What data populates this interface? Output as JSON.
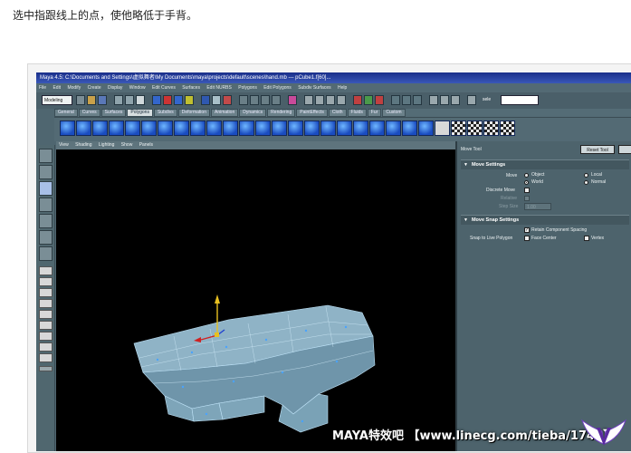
{
  "caption": "选中指跟线上的点，使他略低于手背。",
  "maya": {
    "title": "Maya 4.5: C:\\Documents and Settings\\虚拟舞者\\My Documents\\maya\\projects\\default\\scenes\\hand.mb  ---  pCube1.f[60]...",
    "menus": [
      "File",
      "Edit",
      "Modify",
      "Create",
      "Display",
      "Window",
      "Edit Curves",
      "Surfaces",
      "Edit NURBS",
      "Polygons",
      "Edit Polygons",
      "Subdiv Surfaces",
      "Help"
    ],
    "mode": "Modeling",
    "select_label": "sele",
    "shelf_tabs": [
      "General",
      "Curves",
      "Surfaces",
      "Polygons",
      "Subdivs",
      "Deformation",
      "Animation",
      "Dynamics",
      "Rendering",
      "PaintEffects",
      "Cloth",
      "Fluids",
      "Fur",
      "Custom"
    ],
    "active_shelf_tab": "Polygons",
    "panel_menus": [
      "View",
      "Shading",
      "Lighting",
      "Show",
      "Panels"
    ],
    "tool_settings": {
      "title": "Move Tool",
      "reset_label": "Reset Tool",
      "section1": "Move Settings",
      "move_label": "Move",
      "opt_object": "Object",
      "opt_local": "Local",
      "opt_world": "World",
      "opt_normal": "Normal",
      "discrete_label": "Discrete Move",
      "relative_label": "Relative",
      "stepsize_label": "Step Size",
      "stepsize_value": "1.00",
      "section2": "Move Snap Settings",
      "retain_label": "Retain Component Spacing",
      "snap_label": "Snap to Live Polygon",
      "face_center": "Face Center",
      "vertex": "Vertex"
    },
    "colors": {
      "ui_bg": "#4f6670",
      "titlebar": "#1a2f8a",
      "viewport_bg": "#000000",
      "mesh": "#8fb3c6",
      "selected_point": "#4aa3ff",
      "y_axis": "#e8c020",
      "x_axis": "#d02020",
      "z_axis": "#2040d0"
    }
  },
  "watermark": "MAYA特效吧 【www.linecg.com/tieba/1745】"
}
